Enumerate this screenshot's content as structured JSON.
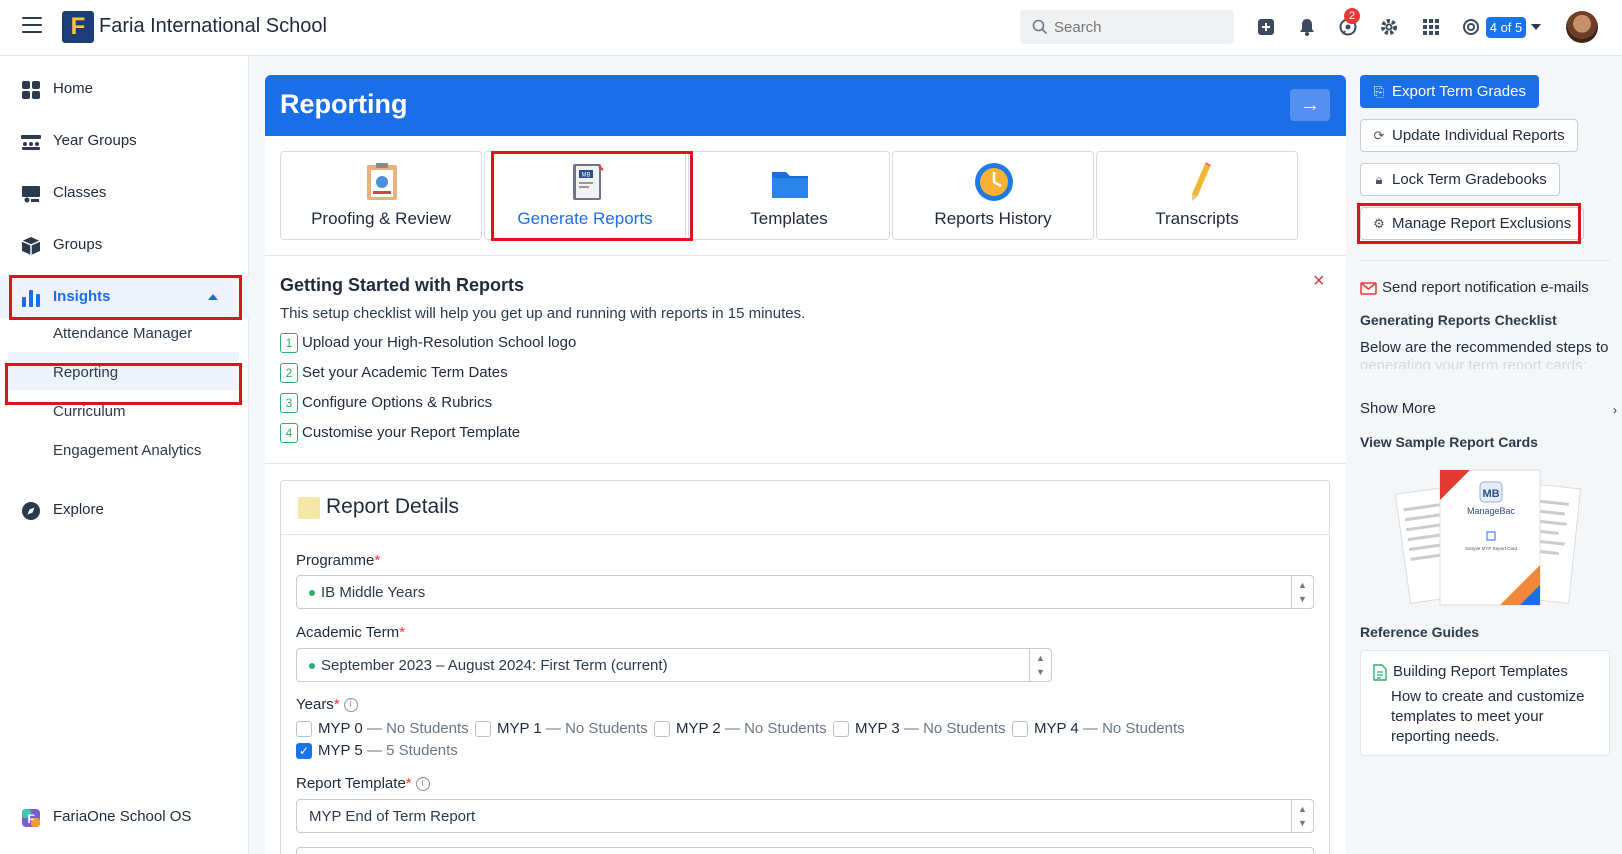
{
  "topbar": {
    "app_name": "Faria International School",
    "logo_letter": "F",
    "search_placeholder": "Search",
    "notification_count": "2",
    "pager": "4 of 5"
  },
  "sidebar": {
    "items": [
      {
        "label": "Home",
        "icon": "grid-icon"
      },
      {
        "label": "Year Groups",
        "icon": "year-groups-icon"
      },
      {
        "label": "Classes",
        "icon": "classes-icon"
      },
      {
        "label": "Groups",
        "icon": "groups-icon"
      },
      {
        "label": "Insights",
        "icon": "bar-chart-icon"
      }
    ],
    "sub_items": [
      "Attendance Manager",
      "Reporting",
      "Curriculum",
      "Engagement Analytics"
    ],
    "explore": "Explore",
    "footer": "FariaOne School OS"
  },
  "main": {
    "title": "Reporting",
    "tiles": [
      {
        "label": "Proofing & Review"
      },
      {
        "label": "Generate Reports",
        "badge": "MB"
      },
      {
        "label": "Templates"
      },
      {
        "label": "Reports History"
      },
      {
        "label": "Transcripts"
      }
    ],
    "getting_started": {
      "title": "Getting Started with Reports",
      "subtitle": "This setup checklist will help you get up and running with reports in 15 minutes.",
      "steps": [
        {
          "num": "1",
          "text": "Upload your High-Resolution School logo"
        },
        {
          "num": "2",
          "text": "Set your Academic Term Dates"
        },
        {
          "num": "3",
          "text": "Configure Options & Rubrics"
        },
        {
          "num": "4",
          "text": "Customise your Report Template"
        }
      ]
    },
    "report_details": {
      "title": "Report Details",
      "programme_label": "Programme",
      "programme_value": "IB Middle Years",
      "term_label": "Academic Term",
      "term_value": "September 2023 – August 2024: First Term (current)",
      "years_label": "Years",
      "years": [
        {
          "name": "MYP 0",
          "count": "— No Students",
          "checked": false
        },
        {
          "name": "MYP 1",
          "count": "— No Students",
          "checked": false
        },
        {
          "name": "MYP 2",
          "count": "— No Students",
          "checked": false
        },
        {
          "name": "MYP 3",
          "count": "— No Students",
          "checked": false
        },
        {
          "name": "MYP 4",
          "count": "— No Students",
          "checked": false
        },
        {
          "name": "MYP 5",
          "count": "— 5 Students",
          "checked": true
        }
      ],
      "template_label": "Report Template",
      "template_value": "MYP End of Term Report"
    }
  },
  "right": {
    "export": "Export Term Grades",
    "update": "Update Individual Reports",
    "lock": "Lock Term Gradebooks",
    "manage": "Manage Report Exclusions",
    "send": "Send report notification e-mails",
    "checklist_title": "Generating Reports Checklist",
    "checklist_text": "Below are the recommended steps to",
    "checklist_faded": "generating your term report cards:",
    "show_more": "Show More",
    "sample_title": "View Sample Report Cards",
    "sample_brand": "ManageBac",
    "sample_card_title": "Sample MYP Report Card",
    "ref_title": "Reference Guides",
    "ref_item_title": "Building Report Templates",
    "ref_item_text": "How to create and customize templates to meet your reporting needs."
  },
  "colors": {
    "primary": "#1a6fe8",
    "highlight": "#e0121b",
    "success": "#2eae6a"
  }
}
